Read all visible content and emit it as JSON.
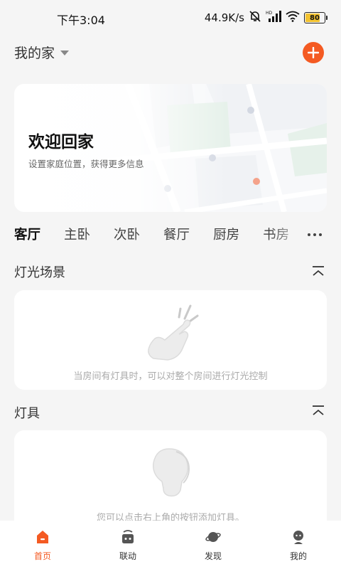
{
  "status_bar": {
    "time": "下午3:04",
    "network_speed": "44.9K/s",
    "battery_level": 80,
    "battery_text": "80",
    "icons": [
      "mute-bell-icon",
      "hd-signal-icon",
      "wifi-icon",
      "battery-icon"
    ]
  },
  "header": {
    "home_name": "我的家",
    "add_icon": "plus-icon",
    "accent_color": "#f45a22"
  },
  "welcome": {
    "title": "欢迎回家",
    "subtitle": "设置家庭位置，获得更多信息"
  },
  "room_tabs": {
    "items": [
      {
        "label": "客厅",
        "active": true
      },
      {
        "label": "主卧",
        "active": false
      },
      {
        "label": "次卧",
        "active": false
      },
      {
        "label": "餐厅",
        "active": false
      },
      {
        "label": "厨房",
        "active": false
      },
      {
        "label": "书房",
        "active": false
      }
    ],
    "more_icon": "more-dots-icon"
  },
  "light_scene": {
    "title": "灯光场景",
    "empty_text": "当房间有灯具时，可以对整个房间进行灯光控制",
    "icon": "tap-hand-icon"
  },
  "fixtures": {
    "title": "灯具",
    "empty_text": "您可以点击右上角的按钮添加灯具。",
    "icon": "bulb-icon"
  },
  "bottom_nav": {
    "items": [
      {
        "label": "首页",
        "icon": "home-icon",
        "active": true
      },
      {
        "label": "联动",
        "icon": "linkage-icon",
        "active": false
      },
      {
        "label": "发现",
        "icon": "planet-icon",
        "active": false
      },
      {
        "label": "我的",
        "icon": "profile-icon",
        "active": false
      }
    ]
  }
}
